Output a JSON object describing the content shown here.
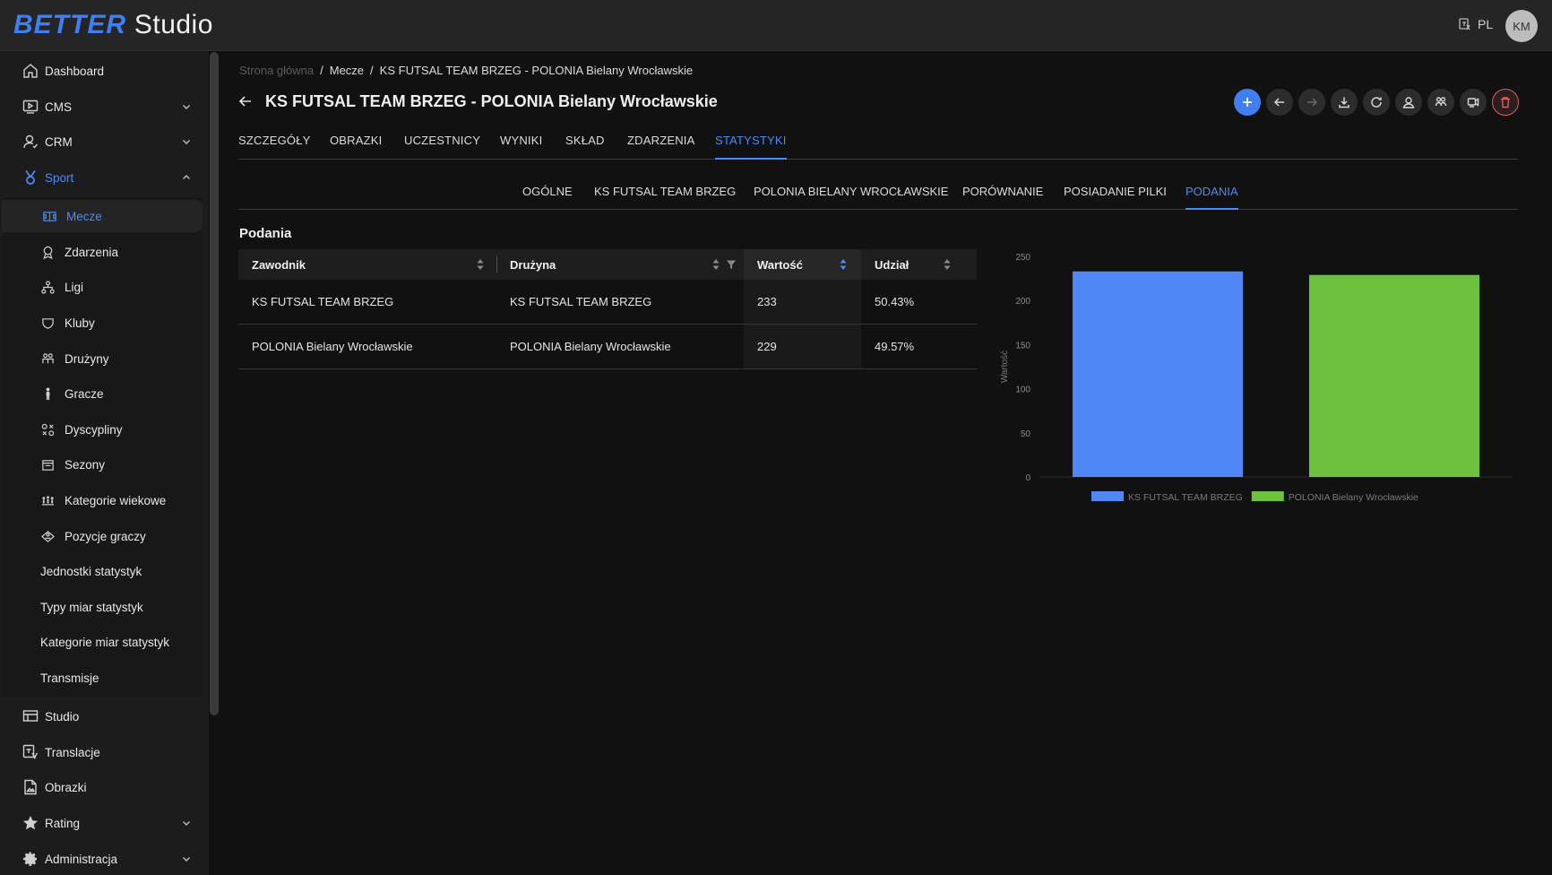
{
  "app": {
    "brand": "BETTER",
    "name": "Studio",
    "lang": "PL",
    "user_initials": "KM"
  },
  "sidebar": {
    "items": [
      {
        "label": "Dashboard",
        "icon": "home-icon"
      },
      {
        "label": "CMS",
        "icon": "monitor-play-icon"
      },
      {
        "label": "CRM",
        "icon": "user-icon"
      },
      {
        "label": "Sport",
        "icon": "medal-icon"
      },
      {
        "label": "Studio",
        "icon": "layout-icon"
      },
      {
        "label": "Translacje",
        "icon": "translate-icon"
      },
      {
        "label": "Obrazki",
        "icon": "image-file-icon"
      },
      {
        "label": "Rating",
        "icon": "star-icon"
      },
      {
        "label": "Administracja",
        "icon": "gear-icon"
      }
    ],
    "sport_items": [
      {
        "label": "Mecze",
        "icon": "pitch-icon"
      },
      {
        "label": "Zdarzenia",
        "icon": "event-icon"
      },
      {
        "label": "Ligi",
        "icon": "hierarchy-icon"
      },
      {
        "label": "Kluby",
        "icon": "shield-icon"
      },
      {
        "label": "Drużyny",
        "icon": "team-icon"
      },
      {
        "label": "Gracze",
        "icon": "player-icon"
      },
      {
        "label": "Dyscypliny",
        "icon": "disciplines-icon"
      },
      {
        "label": "Sezony",
        "icon": "calendar-icon"
      },
      {
        "label": "Kategorie wiekowe",
        "icon": "age-group-icon"
      },
      {
        "label": "Pozycje graczy",
        "icon": "positions-icon"
      },
      {
        "label": "Jednostki statystyk"
      },
      {
        "label": "Typy miar statystyk"
      },
      {
        "label": "Kategorie miar statystyk"
      },
      {
        "label": "Transmisje"
      }
    ]
  },
  "breadcrumb": [
    "Strona główna",
    "Mecze",
    "KS FUTSAL TEAM BRZEG - POLONIA Bielany Wrocławskie"
  ],
  "page": {
    "title": "KS FUTSAL TEAM BRZEG - POLONIA Bielany Wrocławskie"
  },
  "tabs": [
    "SZCZEGÓŁY",
    "OBRAZKI",
    "UCZESTNICY",
    "WYNIKI",
    "SKŁAD",
    "ZDARZENIA",
    "STATYSTYKI"
  ],
  "active_tab": "STATYSTYKI",
  "subtabs": [
    "OGÓLNE",
    "KS FUTSAL TEAM BRZEG",
    "POLONIA BIELANY WROCŁAWSKIE",
    "PORÓWNANIE",
    "POSIADANIE PILKI",
    "PODANIA"
  ],
  "active_subtab": "PODANIA",
  "section": {
    "title": "Podania"
  },
  "table": {
    "headers": [
      "Zawodnik",
      "Drużyna",
      "Wartość",
      "Udział"
    ],
    "rows": [
      [
        "KS FUTSAL TEAM BRZEG",
        "KS FUTSAL TEAM BRZEG",
        "233",
        "50.43%"
      ],
      [
        "POLONIA Bielany Wrocławskie",
        "POLONIA Bielany Wrocławskie",
        "229",
        "49.57%"
      ]
    ]
  },
  "colors": {
    "accent": "#3f7ef3",
    "series1": "#4f88f5",
    "series2": "#6cc13f",
    "danger": "#e35b5b"
  },
  "chart_data": {
    "type": "bar",
    "categories": [
      "KS FUTSAL TEAM BRZEG",
      "POLONIA Bielany Wrocławskie"
    ],
    "series": [
      {
        "name": "KS FUTSAL TEAM BRZEG",
        "values": [
          233,
          null
        ]
      },
      {
        "name": "POLONIA Bielany Wrocławskie",
        "values": [
          null,
          229
        ]
      }
    ],
    "values": [
      233,
      229
    ],
    "ylabel": "Wartość",
    "ylim": [
      0,
      250
    ],
    "yticks": [
      0,
      50,
      100,
      150,
      200,
      250
    ],
    "grid": false,
    "legend": "bottom"
  }
}
